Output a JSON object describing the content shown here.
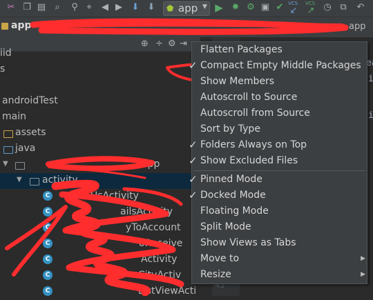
{
  "toolbar": {
    "run_config": "app",
    "vcs_labels": [
      "VCS",
      "VCS"
    ]
  },
  "breadcrumb": {
    "items": [
      "app",
      "app"
    ]
  },
  "tree": {
    "rows": [
      {
        "label": "iid"
      },
      {
        "label": "s"
      },
      {
        "label": "androidTest"
      },
      {
        "label": "main"
      },
      {
        "label": "assets"
      },
      {
        "label": "java"
      },
      {
        "label": "app"
      },
      {
        "label": "activity"
      },
      {
        "label": "UsActivity"
      },
      {
        "label": "ailsActivity"
      },
      {
        "label": "yToAccount"
      },
      {
        "label": "oReceive"
      },
      {
        "label": "Activity"
      },
      {
        "label": "CityActiv"
      },
      {
        "label": "ListViewActi"
      }
    ]
  },
  "editor": {
    "line_number": "43",
    "fragments": [
      "ea",
      "i",
      "i"
    ]
  },
  "menu": {
    "items": [
      {
        "label": "Flatten Packages",
        "checked": false
      },
      {
        "label": "Compact Empty Middle Packages",
        "checked": true
      },
      {
        "label": "Show Members",
        "checked": false
      },
      {
        "label": "Autoscroll to Source",
        "checked": false
      },
      {
        "label": "Autoscroll from Source",
        "checked": false
      },
      {
        "label": "Sort by Type",
        "checked": false
      },
      {
        "label": "Folders Always on Top",
        "checked": true
      },
      {
        "label": "Show Excluded Files",
        "checked": true
      },
      {
        "label": "Pinned Mode",
        "checked": true
      },
      {
        "label": "Docked Mode",
        "checked": true
      },
      {
        "label": "Floating Mode",
        "checked": false
      },
      {
        "label": "Split Mode",
        "checked": false
      },
      {
        "label": "Show Views as Tabs",
        "checked": false
      },
      {
        "label": "Move to",
        "checked": false,
        "submenu": true
      },
      {
        "label": "Resize",
        "checked": false,
        "submenu": true
      }
    ],
    "checkmark": "✓",
    "submenu_arrow": "▶"
  },
  "colors": {
    "panel_bg": "#3c3f41",
    "editor_bg": "#2b2b2b",
    "selection": "#0d293e",
    "redaction": "#ff2d2d"
  }
}
